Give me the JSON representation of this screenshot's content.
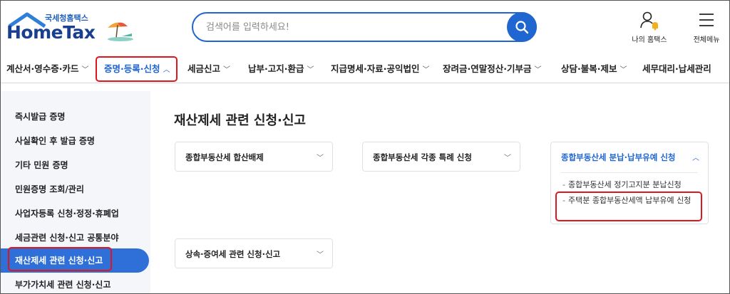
{
  "logo": {
    "subtitle": "국세청홈택스",
    "title": "HomeTax"
  },
  "search": {
    "placeholder": "검색어를 입력하세요!"
  },
  "header": {
    "my_home_label": "나의 홈택스",
    "all_menu_label": "전체메뉴"
  },
  "gnb": {
    "items": [
      {
        "label": "계산서·영수증·카드"
      },
      {
        "label": "증명·등록·신청"
      },
      {
        "label": "세금신고"
      },
      {
        "label": "납부·고지·환급"
      },
      {
        "label": "지급명세·자료·공익법인"
      },
      {
        "label": "장려금·연말정산·기부금"
      },
      {
        "label": "상담·불복·제보"
      },
      {
        "label": "세무대리·납세관리"
      }
    ],
    "active_index": 1
  },
  "sidebar": {
    "items": [
      {
        "label": "즉시발급 증명"
      },
      {
        "label": "사실확인 후 발급 증명"
      },
      {
        "label": "기타 민원 증명"
      },
      {
        "label": "민원증명 조회/관리"
      },
      {
        "label": "사업자등록 신청·정정·휴폐업"
      },
      {
        "label": "세금관련 신청·신고 공통분야"
      },
      {
        "label": "재산제세 관련 신청·신고"
      },
      {
        "label": "부가가치세 관련 신청·신고"
      }
    ],
    "active_index": 6
  },
  "main": {
    "title": "재산제세 관련 신청·신고",
    "cards": [
      {
        "label": "종합부동산세 합산배제"
      },
      {
        "label": "종합부동산세 각종 특례 신청"
      },
      {
        "label": "종합부동산세 분납·납부유예 신청",
        "sub_items": [
          {
            "label": "종합부동산세 정기고지분 분납신청"
          },
          {
            "label": "주택분 종합부동산세액 납부유예 신청"
          }
        ]
      },
      {
        "label": "상속·증여세 관련 신청·신고"
      }
    ]
  },
  "colors": {
    "accent": "#1f66d1",
    "highlight": "#e0161f",
    "sidebar_active": "#2f6fd8"
  }
}
